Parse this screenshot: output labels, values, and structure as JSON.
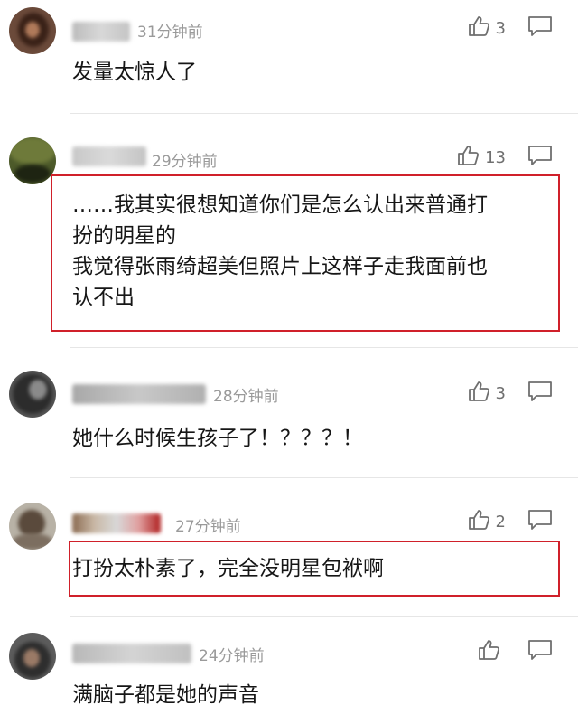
{
  "colors": {
    "highlight_border": "#d0202a",
    "timestamp": "#9a9a9a",
    "divider": "#e6e6e6"
  },
  "icons": {
    "like": "thumbs-up-icon",
    "reply": "reply-bubble-icon"
  },
  "comments": [
    {
      "time": "31分钟前",
      "likes": "3",
      "lines": [
        "发量太惊人了"
      ]
    },
    {
      "time": "29分钟前",
      "likes": "13",
      "lines": [
        "……我其实很想知道你们是怎么认出来普通打",
        "扮的明星的",
        "我觉得张雨绮超美但照片上这样子走我面前也",
        "认不出"
      ]
    },
    {
      "time": "28分钟前",
      "likes": "3",
      "lines": [
        "她什么时候生孩子了！？？？！"
      ]
    },
    {
      "time": "27分钟前",
      "likes": "2",
      "lines": [
        "打扮太朴素了，完全没明星包袱啊"
      ]
    },
    {
      "time": "24分钟前",
      "likes": "",
      "lines": [
        "满脑子都是她的声音"
      ]
    }
  ]
}
